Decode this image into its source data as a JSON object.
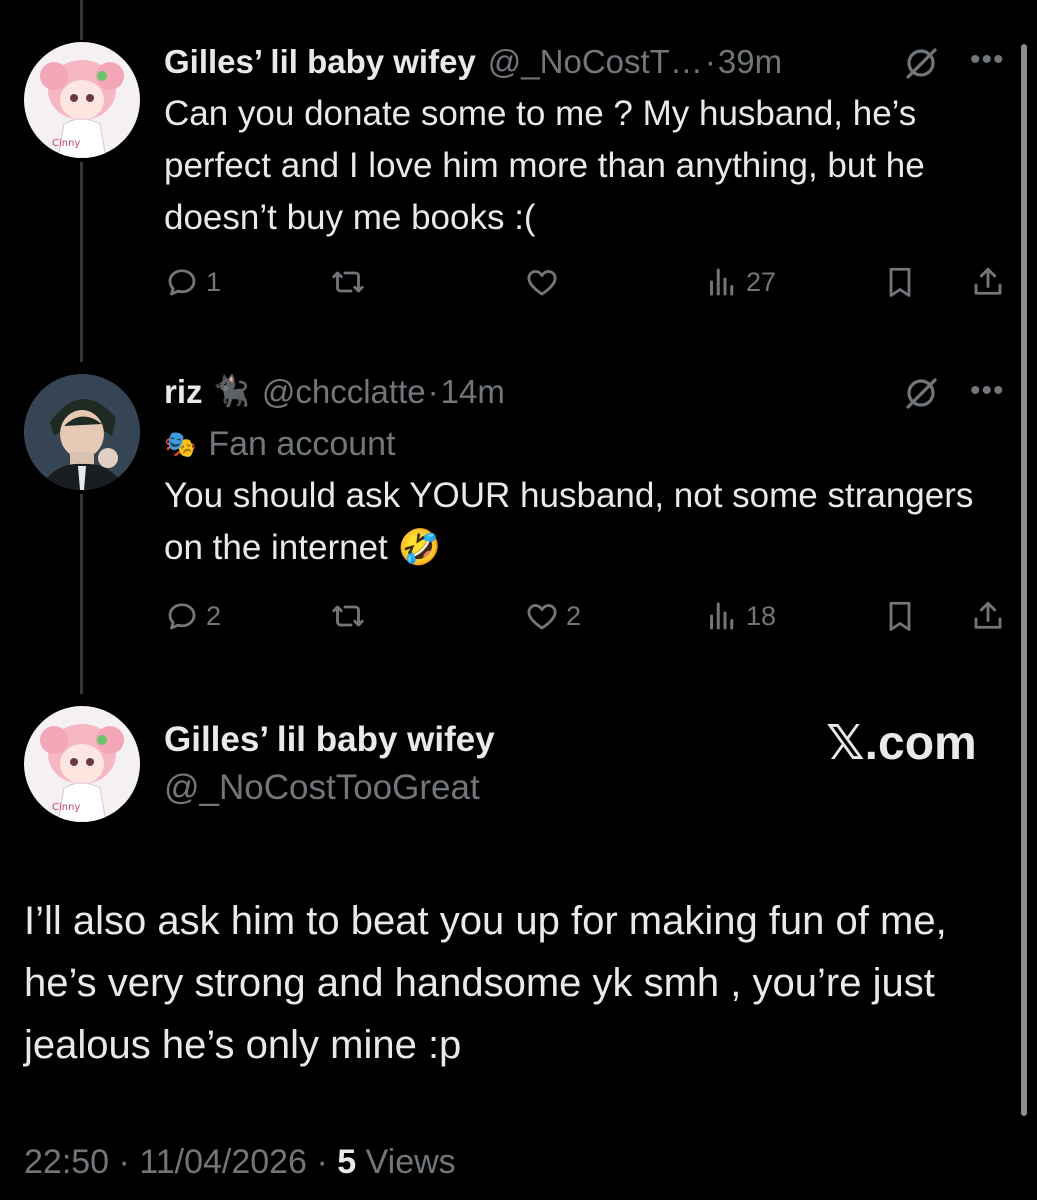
{
  "tweets": [
    {
      "name": "Gilles’ lil baby wifey",
      "handle": "@_NoCostT…",
      "separator": "·",
      "time": "39m",
      "text": "Can you donate some to me ? My husband, he’s perfect and I love him more than anything, but he doesn’t buy me books :(",
      "replies": "1",
      "retweets": "",
      "likes": "",
      "views": "27"
    },
    {
      "name": "riz",
      "name_emoji": "🐈‍⬛",
      "handle": "@chcclatte",
      "separator": "·",
      "time": "14m",
      "label_emoji": "🎭",
      "label": "Fan account",
      "text": "You should ask YOUR husband, not some strangers on the internet 🤣",
      "replies": "2",
      "retweets": "",
      "likes": "2",
      "views": "18"
    }
  ],
  "main": {
    "name": "Gilles’ lil baby wifey",
    "handle": "@_NoCostTooGreat",
    "watermark": "𝕏.com",
    "text": "I’ll also ask him to beat you up for making fun of me, he’s very strong and handsome yk smh , you’re just jealous he’s only mine :p",
    "time": "22:50",
    "date": "11/04/2026",
    "dot": "·",
    "views_count": "5",
    "views_label": "Views"
  },
  "icons": [
    "reply-icon",
    "retweet-icon",
    "like-icon",
    "views-icon",
    "bookmark-icon",
    "share-icon",
    "grok-icon",
    "more-icon"
  ],
  "colors": {
    "background": "#000000",
    "text": "#e7e9ea",
    "secondary": "#71767b",
    "thread_line": "#333639"
  }
}
